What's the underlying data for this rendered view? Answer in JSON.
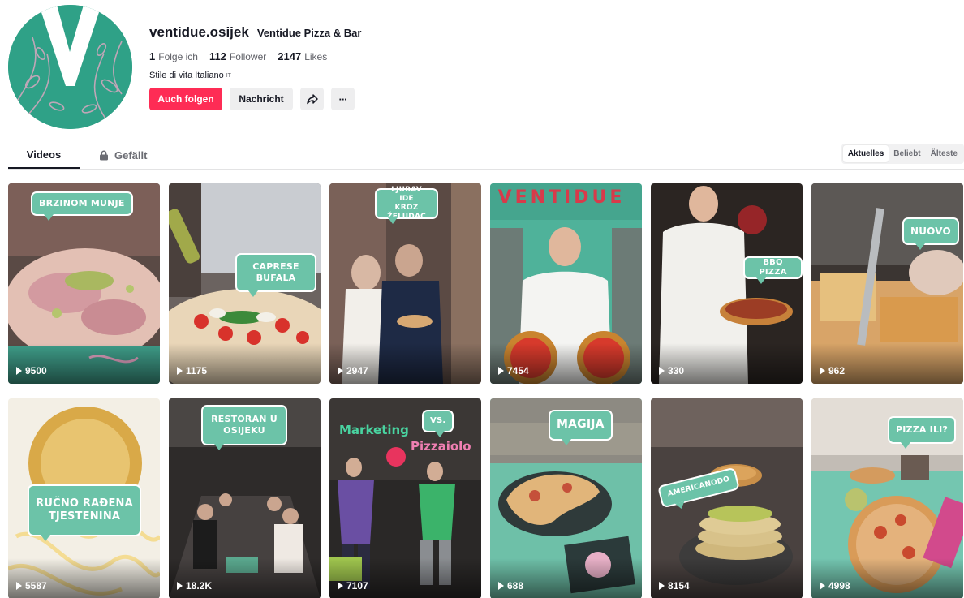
{
  "profile": {
    "username": "ventidue.osijek",
    "nickname": "Ventidue Pizza & Bar",
    "stats": [
      {
        "value": "1",
        "label": "Folge ich"
      },
      {
        "value": "112",
        "label": "Follower"
      },
      {
        "value": "2147",
        "label": "Likes"
      }
    ],
    "bio": "Stile di vita Italiano",
    "bio_lang": "IT",
    "follow_label": "Auch folgen",
    "message_label": "Nachricht",
    "share_icon": "share-icon",
    "more_icon": "more-icon",
    "more_label": "···",
    "avatar_color": "#2fa187"
  },
  "tabs": {
    "videos": "Videos",
    "liked": "Gefällt",
    "liked_icon": "lock-icon"
  },
  "sort": {
    "options": [
      "Aktuelles",
      "Beliebt",
      "Älteste"
    ],
    "active": "Aktuelles"
  },
  "colors": {
    "accent": "#fe2c55",
    "bubble": "#6cc3a8"
  },
  "videos": [
    {
      "views": "9500",
      "caption": "BRZINOM MUNJE"
    },
    {
      "views": "1175",
      "caption": "CAPRESE\nBUFALA"
    },
    {
      "views": "2947",
      "caption": "LJUBAV IDE\nKROZ ŽELUDAC"
    },
    {
      "views": "7454",
      "caption": "",
      "sign": "VENTIDUE"
    },
    {
      "views": "330",
      "caption": "BBQ PIZZA"
    },
    {
      "views": "962",
      "caption": "NUOVO"
    },
    {
      "views": "5587",
      "caption": "RUČNO RAĐENA\nTJESTENINA"
    },
    {
      "views": "18.2K",
      "caption": "RESTORAN U\nOSIJEKU"
    },
    {
      "views": "7107",
      "caption": "VS.",
      "text_left": "Marketing",
      "text_right": "Pizzaiolo"
    },
    {
      "views": "688",
      "caption": "MAGIJA"
    },
    {
      "views": "8154",
      "caption": "AMERICANODO"
    },
    {
      "views": "4998",
      "caption": "PIZZA ILI?"
    }
  ]
}
